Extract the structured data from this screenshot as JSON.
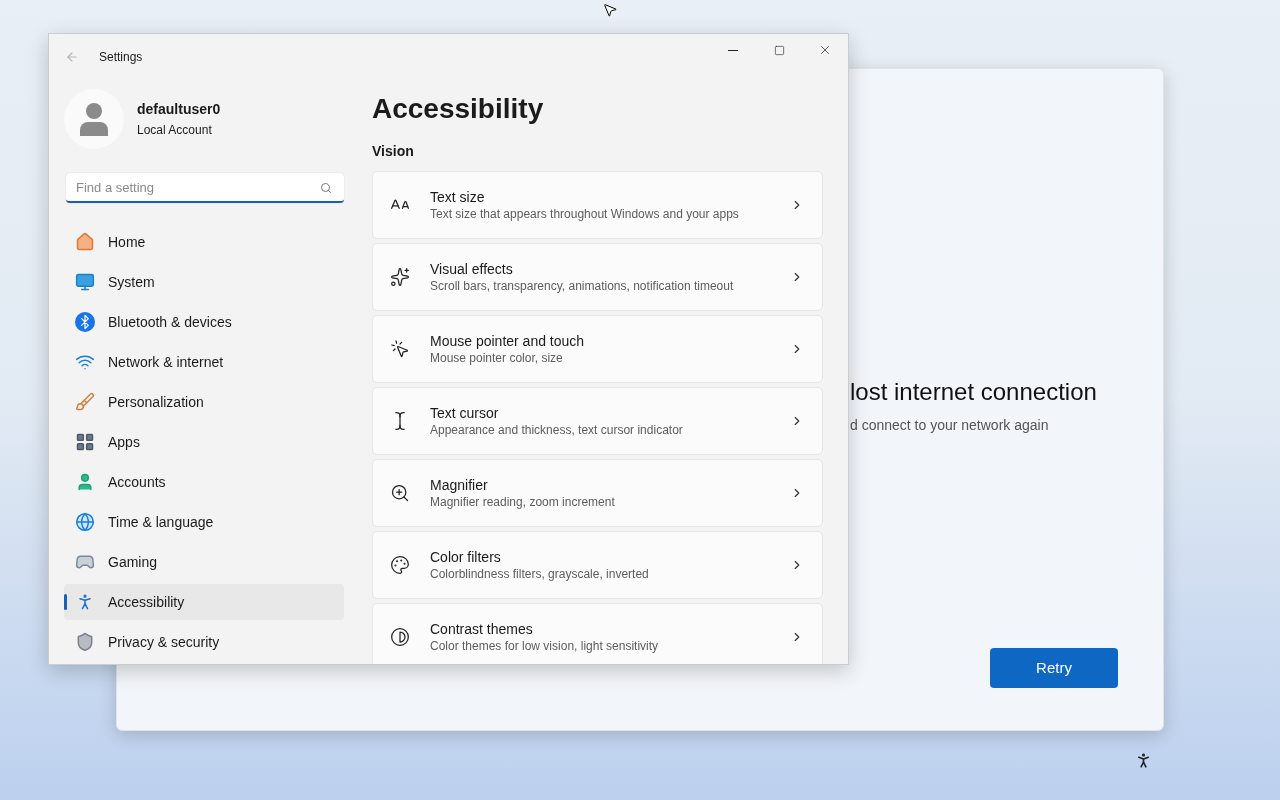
{
  "settings_window": {
    "title": "Settings",
    "user": {
      "name": "defaultuser0",
      "account_type": "Local Account"
    },
    "search": {
      "placeholder": "Find a setting"
    },
    "nav_items": [
      {
        "label": "Home",
        "selected": false
      },
      {
        "label": "System",
        "selected": false
      },
      {
        "label": "Bluetooth & devices",
        "selected": false
      },
      {
        "label": "Network & internet",
        "selected": false
      },
      {
        "label": "Personalization",
        "selected": false
      },
      {
        "label": "Apps",
        "selected": false
      },
      {
        "label": "Accounts",
        "selected": false
      },
      {
        "label": "Time & language",
        "selected": false
      },
      {
        "label": "Gaming",
        "selected": false
      },
      {
        "label": "Accessibility",
        "selected": true
      },
      {
        "label": "Privacy & security",
        "selected": false
      }
    ],
    "page_title": "Accessibility",
    "section": "Vision",
    "items": [
      {
        "title": "Text size",
        "description": "Text size that appears throughout Windows and your apps"
      },
      {
        "title": "Visual effects",
        "description": "Scroll bars, transparency, animations, notification timeout"
      },
      {
        "title": "Mouse pointer and touch",
        "description": "Mouse pointer color, size"
      },
      {
        "title": "Text cursor",
        "description": "Appearance and thickness, text cursor indicator"
      },
      {
        "title": "Magnifier",
        "description": "Magnifier reading, zoom increment"
      },
      {
        "title": "Color filters",
        "description": "Colorblindness filters, grayscale, inverted"
      },
      {
        "title": "Contrast themes",
        "description": "Color themes for low vision, light sensitivity"
      }
    ]
  },
  "setup_window": {
    "heading": "lost internet connection",
    "message": "d connect to your network again",
    "button": "Retry"
  }
}
